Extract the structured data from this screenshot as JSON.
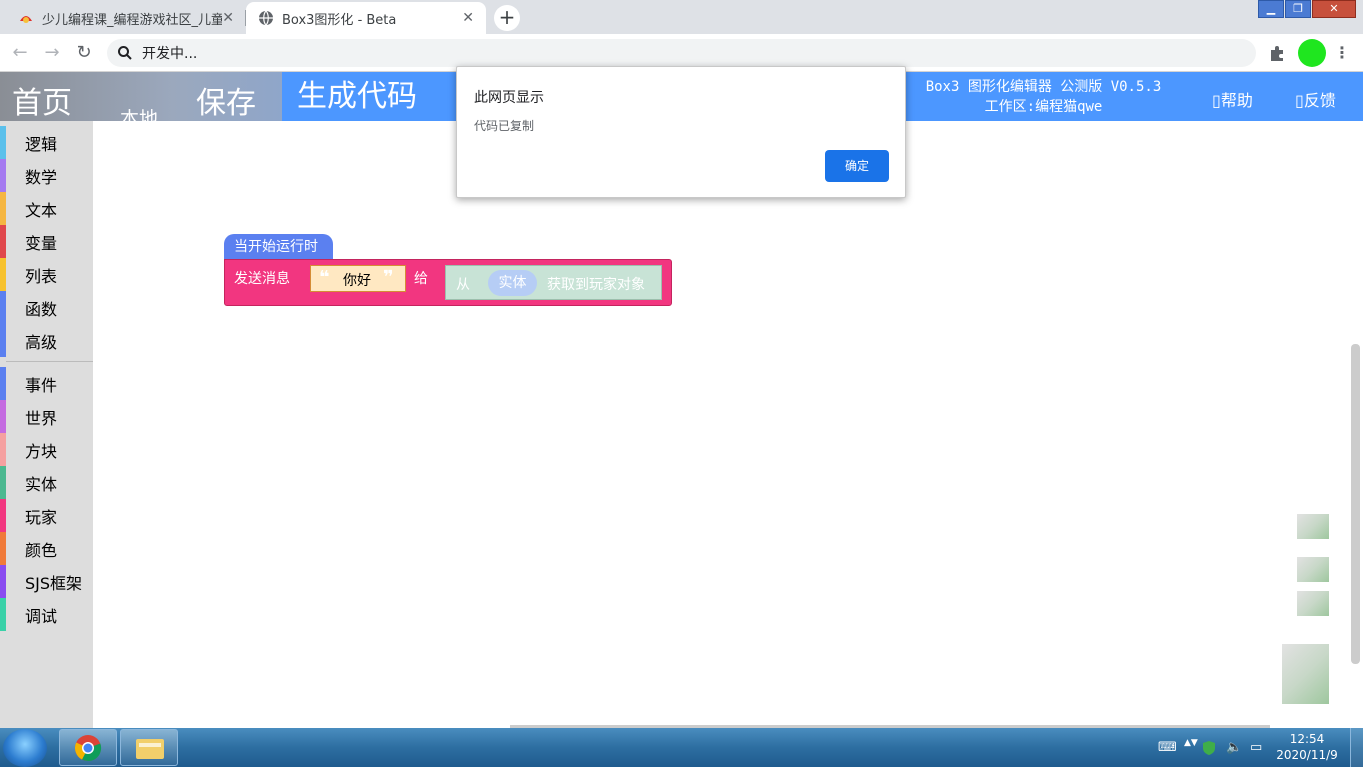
{
  "browser": {
    "tabs": [
      {
        "title": "少儿编程课_编程游戏社区_儿童编程",
        "active": false
      },
      {
        "title": "Box3图形化 - Beta",
        "active": true
      }
    ],
    "new_tab": "+",
    "address": "开发中...",
    "window_controls": {
      "minimize": "▁",
      "maximize": "❐",
      "close": "✕"
    }
  },
  "app": {
    "nav": {
      "home": "首页",
      "local": "本地",
      "save": "保存",
      "generate": "生成代码"
    },
    "version": "Box3 图形化编辑器 公测版 V0.5.3",
    "workspace": "工作区:编程猫qwe",
    "help": "帮助",
    "feedback": "反馈",
    "accent_color": "#4c97ff"
  },
  "toolbox": {
    "group1": [
      {
        "label": "逻辑",
        "color": "#5bc0eb"
      },
      {
        "label": "数学",
        "color": "#a57af0"
      },
      {
        "label": "文本",
        "color": "#f5b642"
      },
      {
        "label": "变量",
        "color": "#e0474c"
      },
      {
        "label": "列表",
        "color": "#f7c22e"
      },
      {
        "label": "函数",
        "color": "#5b80f0"
      },
      {
        "label": "高级",
        "color": "#5b80f0"
      }
    ],
    "group2": [
      {
        "label": "事件",
        "color": "#5b80f0"
      },
      {
        "label": "世界",
        "color": "#c46be0"
      },
      {
        "label": "方块",
        "color": "#f5a0a0"
      },
      {
        "label": "实体",
        "color": "#4cb890"
      },
      {
        "label": "玩家",
        "color": "#f23680"
      },
      {
        "label": "颜色",
        "color": "#f07a3a"
      },
      {
        "label": "SJS框架",
        "color": "#8a4cf0"
      },
      {
        "label": "调试",
        "color": "#3ad1a8"
      }
    ]
  },
  "blocks": {
    "event": "当开始运行时",
    "send_label": "发送消息",
    "message": "你好",
    "to_label": "给",
    "from_label": "从",
    "entity_label": "实体",
    "get_label": "获取到玩家对象"
  },
  "dialog": {
    "title": "此网页显示",
    "message": "代码已复制",
    "ok": "确定"
  },
  "taskbar": {
    "time": "12:54",
    "date": "2020/11/9"
  }
}
